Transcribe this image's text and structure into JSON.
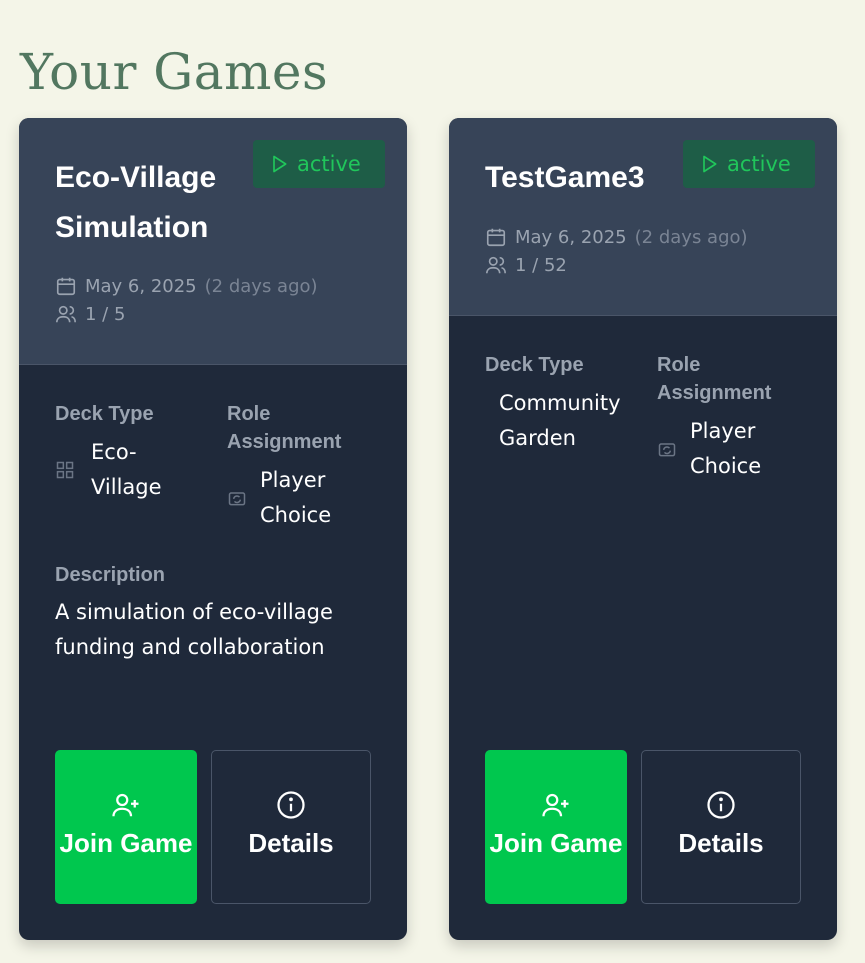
{
  "page": {
    "title": "Your Games"
  },
  "colors": {
    "accent": "#00c74e",
    "status": "#20c65b",
    "card_bg": "#1f293a",
    "card_header_bg": "#374458"
  },
  "games": [
    {
      "title": "Eco-Village Simulation",
      "status": "active",
      "date": "May 6, 2025",
      "ago": "(2 days ago)",
      "players": "1 / 5",
      "deck_type_label": "Deck Type",
      "deck_type": "Eco-Village",
      "role_label": "Role Assignment",
      "role": "Player Choice",
      "description_label": "Description",
      "description": "A simulation of eco-village funding and collaboration",
      "join_label": "Join Game",
      "details_label": "Details"
    },
    {
      "title": "TestGame3",
      "status": "active",
      "date": "May 6, 2025",
      "ago": "(2 days ago)",
      "players": "1 / 52",
      "deck_type_label": "Deck Type",
      "deck_type": "Community Garden",
      "role_label": "Role Assignment",
      "role": "Player Choice",
      "join_label": "Join Game",
      "details_label": "Details"
    }
  ]
}
